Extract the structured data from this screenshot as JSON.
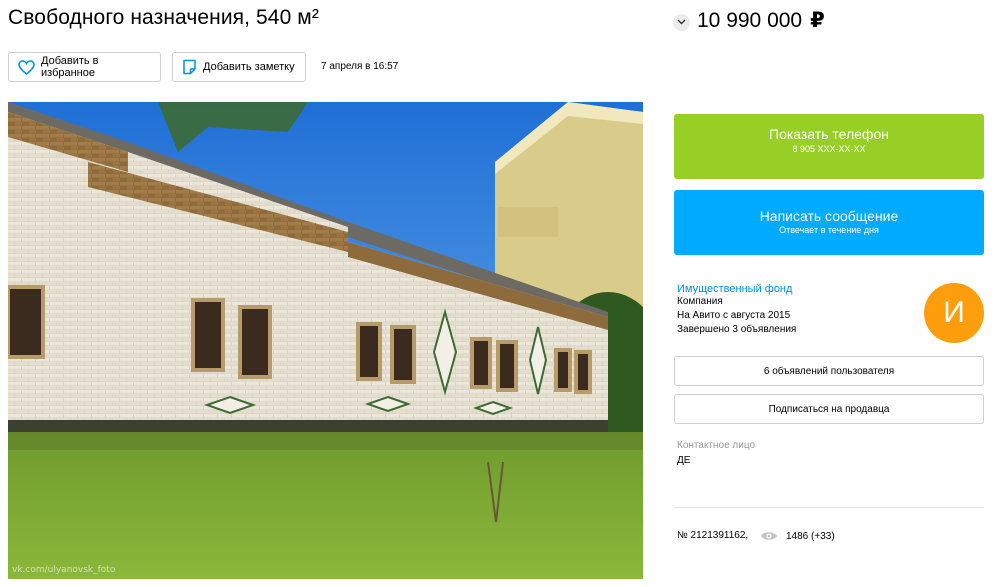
{
  "listing": {
    "title": "Свободного назначения, 540 м²",
    "price": "10 990 000",
    "currency_symbol": "₽",
    "favorite_label": "Добавить в избранное",
    "note_label": "Добавить заметку",
    "date": "7 апреля в 16:57",
    "photo_watermark": "vk.com/ulyanovsk_foto"
  },
  "contact": {
    "phone_label": "Показать телефон",
    "phone_masked": "8 905 XXX-XX-XX",
    "message_label": "Написать сообщение",
    "message_sub": "Отвечает в течение дня"
  },
  "seller": {
    "name": "Имущественный фонд",
    "type": "Компания",
    "since": "На Авито с августа 2015",
    "completed": "Завершено 3 объявления",
    "avatar_letter": "И",
    "avatar_color": "#ff9e0d",
    "user_ads_label": "6 объявлений пользователя",
    "subscribe_label": "Подписаться на продавца",
    "contact_person_label": "Контактное лицо",
    "contact_person_value": "ДЕ"
  },
  "meta": {
    "ad_number": "№ 2121391162,",
    "views": "1486 (+33)"
  },
  "colors": {
    "phone_button": "#97cf26",
    "message_button": "#00aaff",
    "link": "#0091d9"
  },
  "icons": {
    "favorite": "heart-icon",
    "note": "note-icon",
    "price_toggle": "chevron-down-icon",
    "views": "eye-icon"
  }
}
